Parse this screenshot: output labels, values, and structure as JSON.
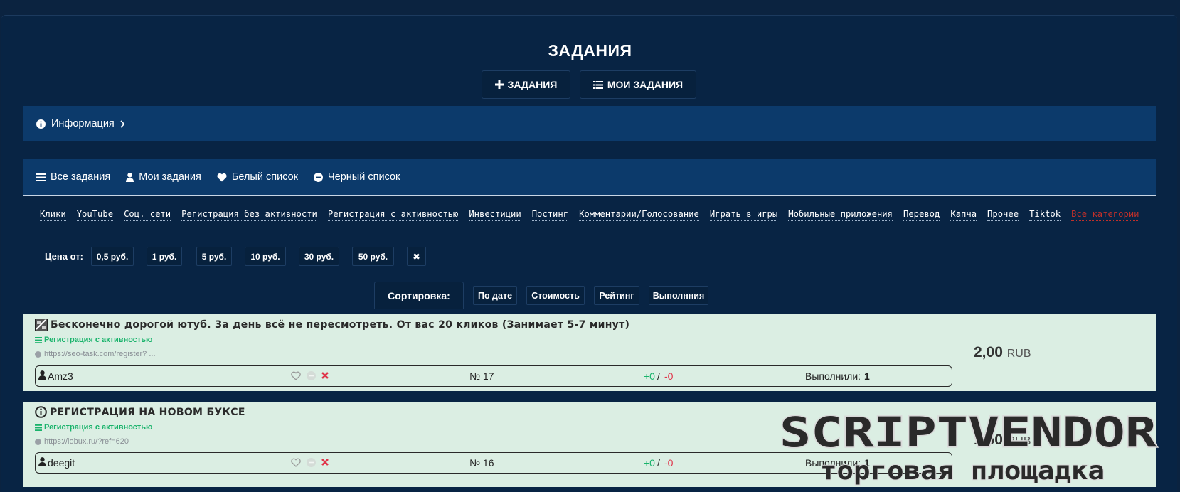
{
  "title": "ЗАДАНИЯ",
  "top_buttons": {
    "add": "ЗАДАНИЯ",
    "mine": "МОИ ЗАДАНИЯ"
  },
  "info": {
    "label": "Информация"
  },
  "tabs": [
    "Все задания",
    "Мои задания",
    "Белый список",
    "Черный список"
  ],
  "categories": [
    "Клики",
    "YouTube",
    "Соц. сети",
    "Регистрация без активности",
    "Регистрация с активностью",
    "Инвестиции",
    "Постинг",
    "Комментарии/Голосование",
    "Играть в игры",
    "Мобильные приложения",
    "Перевод",
    "Капча",
    "Прочее",
    "Tiktok",
    "Все категории"
  ],
  "price_filter": {
    "label": "Цена от:",
    "options": [
      "0,5 руб.",
      "1 руб.",
      "5 руб.",
      "10 руб.",
      "30 руб.",
      "50 руб."
    ],
    "clear": "✖"
  },
  "sort": {
    "label": "Сортировка:",
    "options": [
      "По дате",
      "Стоимость",
      "Рейтинг",
      "Выполнния"
    ]
  },
  "tasks": [
    {
      "title": "Бесконечно дорогой ютуб. За день всё не пересмотреть. От вас 20 кликов (Занимает 5-7 минут)",
      "category": "Регистрация с активностью",
      "url": "https://seo-task.com/register? ...",
      "user": "Amz3",
      "number": "№ 17",
      "plus": "+0",
      "slash": "/",
      "minus": "-0",
      "done_label": "Выполнили:",
      "done_count": "1",
      "price": "2,00",
      "currency": "RUB"
    },
    {
      "title": "РЕГИСТРАЦИЯ НА НОВОМ БУКСЕ",
      "category": "Регистрация с активностью",
      "url": "https://iobux.ru/?ref=620",
      "user": "deegit",
      "number": "№ 16",
      "plus": "+0",
      "slash": "/",
      "minus": "-0",
      "done_label": "Выполнили:",
      "done_count": "1",
      "price": "1,50",
      "currency": "RUB"
    }
  ],
  "watermark": {
    "line1": "SCRIPTVENDOR",
    "line2": "торговая площадка"
  }
}
